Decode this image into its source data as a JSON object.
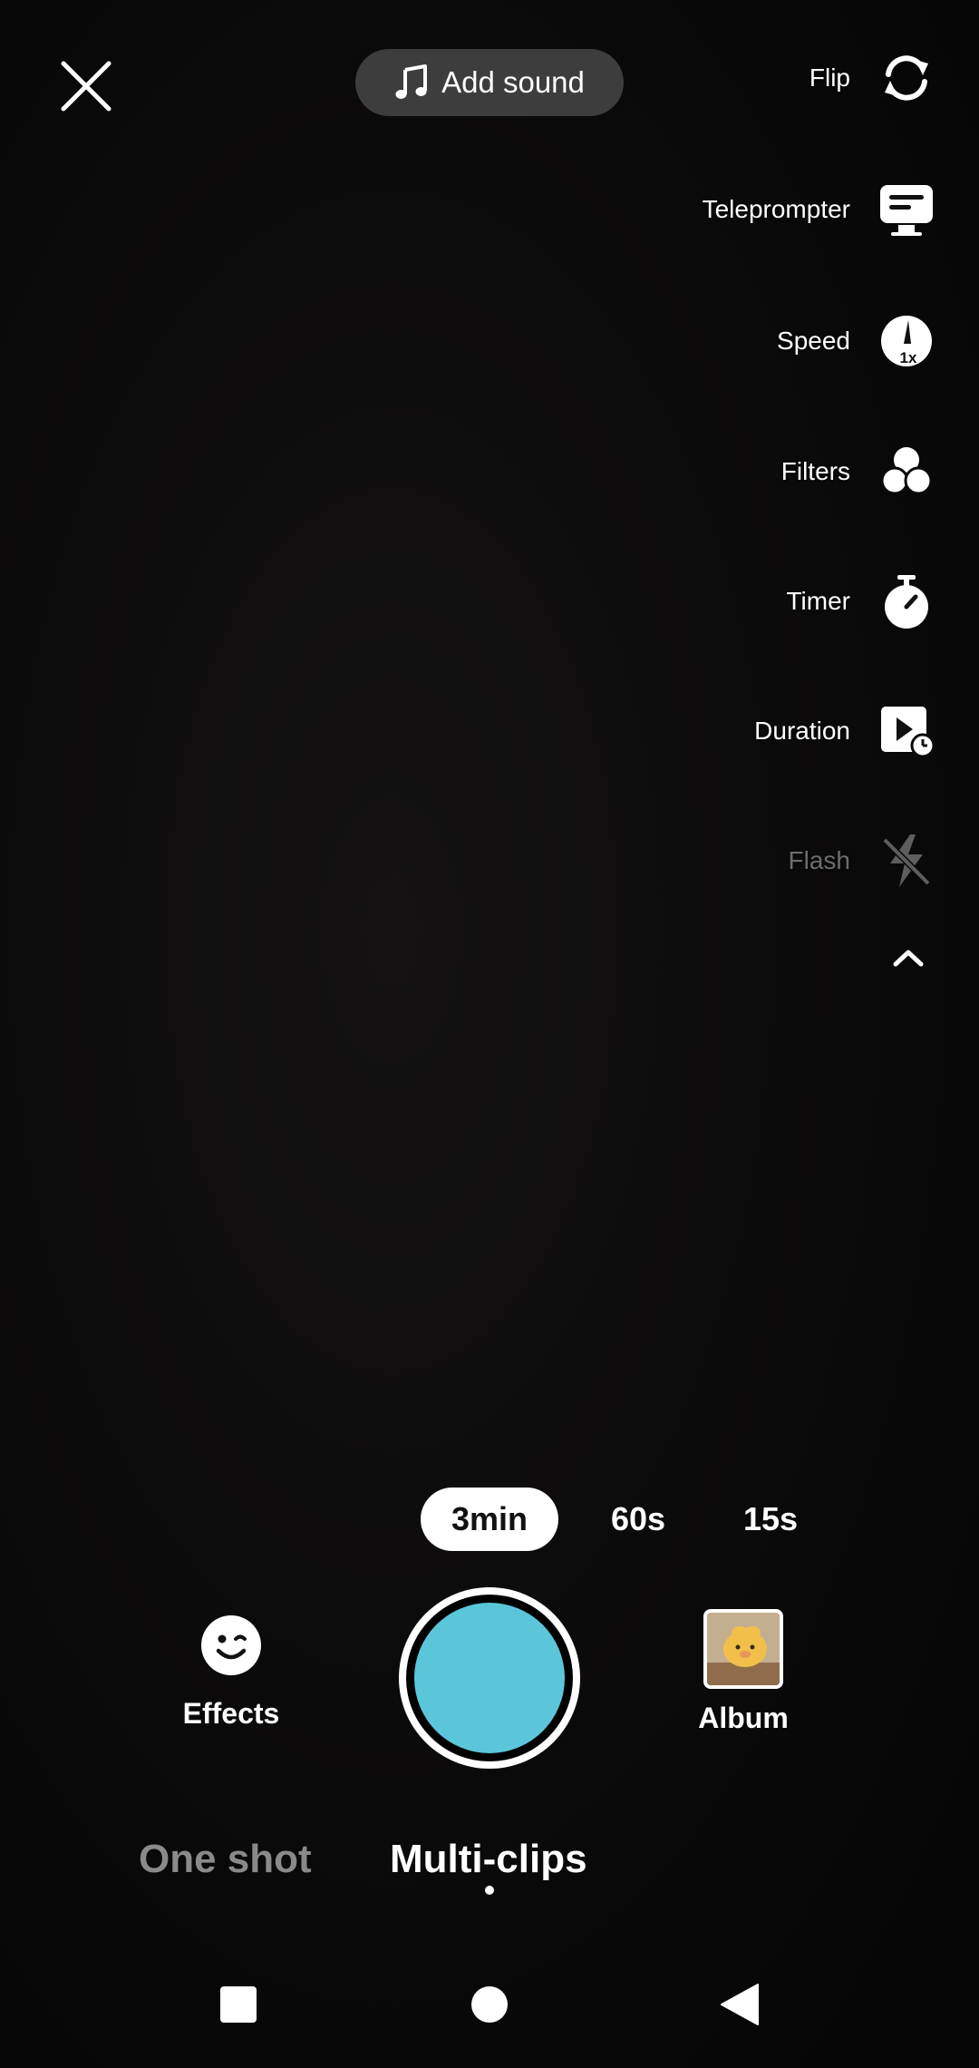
{
  "top": {
    "close_icon": "close-icon",
    "add_sound": {
      "icon": "music-note-icon",
      "label": "Add sound"
    }
  },
  "tools": [
    {
      "key": "flip",
      "label": "Flip",
      "icon": "flip-camera-icon",
      "enabled": true
    },
    {
      "key": "teleprompter",
      "label": "Teleprompter",
      "icon": "teleprompter-icon",
      "enabled": true
    },
    {
      "key": "speed",
      "label": "Speed",
      "icon": "speed-icon",
      "badge": "1x",
      "enabled": true
    },
    {
      "key": "filters",
      "label": "Filters",
      "icon": "filters-icon",
      "enabled": true
    },
    {
      "key": "timer",
      "label": "Timer",
      "icon": "timer-icon",
      "enabled": true
    },
    {
      "key": "duration",
      "label": "Duration",
      "icon": "duration-icon",
      "enabled": true
    },
    {
      "key": "flash",
      "label": "Flash",
      "icon": "flash-off-icon",
      "enabled": false
    }
  ],
  "collapse_icon": "chevron-up-icon",
  "durations": {
    "options": [
      "3min",
      "60s",
      "15s"
    ],
    "selected": "3min"
  },
  "bottom": {
    "effects_label": "Effects",
    "album_label": "Album",
    "record_color": "#5bc6da"
  },
  "modes": {
    "items": [
      "One shot",
      "Multi-clips"
    ],
    "selected": "Multi-clips"
  },
  "colors": {
    "accent": "#5bc6da",
    "inactive_text": "#8a8a8a",
    "disabled_text": "#6d6d6d"
  }
}
